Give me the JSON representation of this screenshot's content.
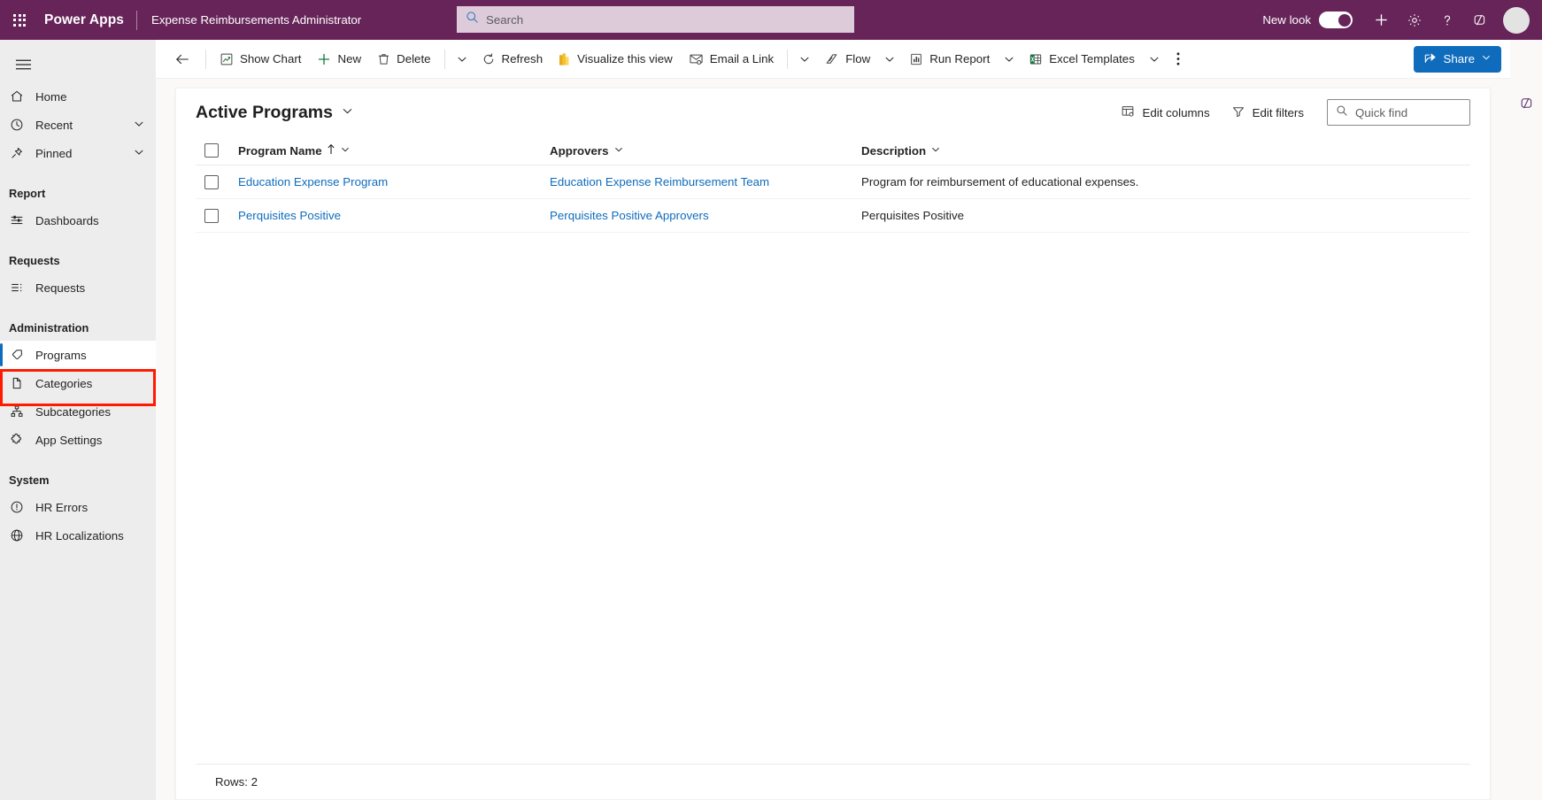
{
  "topbar": {
    "waffle_label": "app-launcher",
    "brand": "Power Apps",
    "app_name": "Expense Reimbursements Administrator",
    "search_placeholder": "Search",
    "new_look_label": "New look",
    "new_look_on": true,
    "icons": [
      "add-icon",
      "settings-gear-icon",
      "help-question-icon",
      "copilot-icon"
    ],
    "brand_color": "#662459",
    "search_bg": "#ddcbda"
  },
  "sidebar": {
    "hamburger": "hamburger-icon",
    "items": [
      {
        "label": "Home",
        "icon": "home-icon",
        "expandable": false,
        "selected": false
      },
      {
        "label": "Recent",
        "icon": "clock-icon",
        "expandable": true,
        "selected": false
      },
      {
        "label": "Pinned",
        "icon": "pin-icon",
        "expandable": true,
        "selected": false
      }
    ],
    "groups": [
      {
        "title": "Report",
        "items": [
          {
            "label": "Dashboards",
            "icon": "dashboard-icon",
            "selected": false
          }
        ]
      },
      {
        "title": "Requests",
        "items": [
          {
            "label": "Requests",
            "icon": "list-icon",
            "selected": false
          }
        ]
      },
      {
        "title": "Administration",
        "items": [
          {
            "label": "Programs",
            "icon": "tag-icon",
            "selected": true
          },
          {
            "label": "Categories",
            "icon": "document-icon",
            "selected": false
          },
          {
            "label": "Subcategories",
            "icon": "hierarchy-icon",
            "selected": false
          },
          {
            "label": "App Settings",
            "icon": "puzzle-icon",
            "selected": false
          }
        ]
      },
      {
        "title": "System",
        "items": [
          {
            "label": "HR Errors",
            "icon": "error-circle-icon",
            "selected": false
          },
          {
            "label": "HR Localizations",
            "icon": "globe-icon",
            "selected": false
          }
        ]
      }
    ],
    "highlight_color": "#ff1a00",
    "selected_accent": "#0f6cbd"
  },
  "commandbar": {
    "back": "back-arrow-icon",
    "commands": [
      {
        "label": "Show Chart",
        "icon": "chart-icon"
      },
      {
        "label": "New",
        "icon": "plus-icon"
      },
      {
        "label": "Delete",
        "icon": "trash-icon"
      },
      {
        "label": "Refresh",
        "icon": "refresh-icon"
      },
      {
        "label": "Visualize this view",
        "icon": "powerbi-icon"
      },
      {
        "label": "Email a Link",
        "icon": "email-link-icon"
      },
      {
        "label": "Flow",
        "icon": "flow-icon"
      },
      {
        "label": "Run Report",
        "icon": "report-icon"
      },
      {
        "label": "Excel Templates",
        "icon": "excel-icon"
      }
    ],
    "overflow": "more-vertical-icon",
    "share_label": "Share",
    "share_color": "#0f6cbd"
  },
  "view": {
    "title": "Active Programs",
    "edit_columns_label": "Edit columns",
    "edit_filters_label": "Edit filters",
    "quick_find_placeholder": "Quick find"
  },
  "grid": {
    "columns": [
      {
        "label": "Program Name",
        "sorted": "asc"
      },
      {
        "label": "Approvers",
        "sorted": ""
      },
      {
        "label": "Description",
        "sorted": ""
      }
    ],
    "rows": [
      {
        "name": "Education Expense Program",
        "approvers": "Education Expense Reimbursement Team",
        "description": "Program for reimbursement of educational expenses."
      },
      {
        "name": "Perquisites Positive",
        "approvers": "Perquisites Positive Approvers",
        "description": "Perquisites Positive"
      }
    ],
    "footer": "Rows: 2"
  },
  "rail": {
    "icon": "copilot-icon"
  }
}
